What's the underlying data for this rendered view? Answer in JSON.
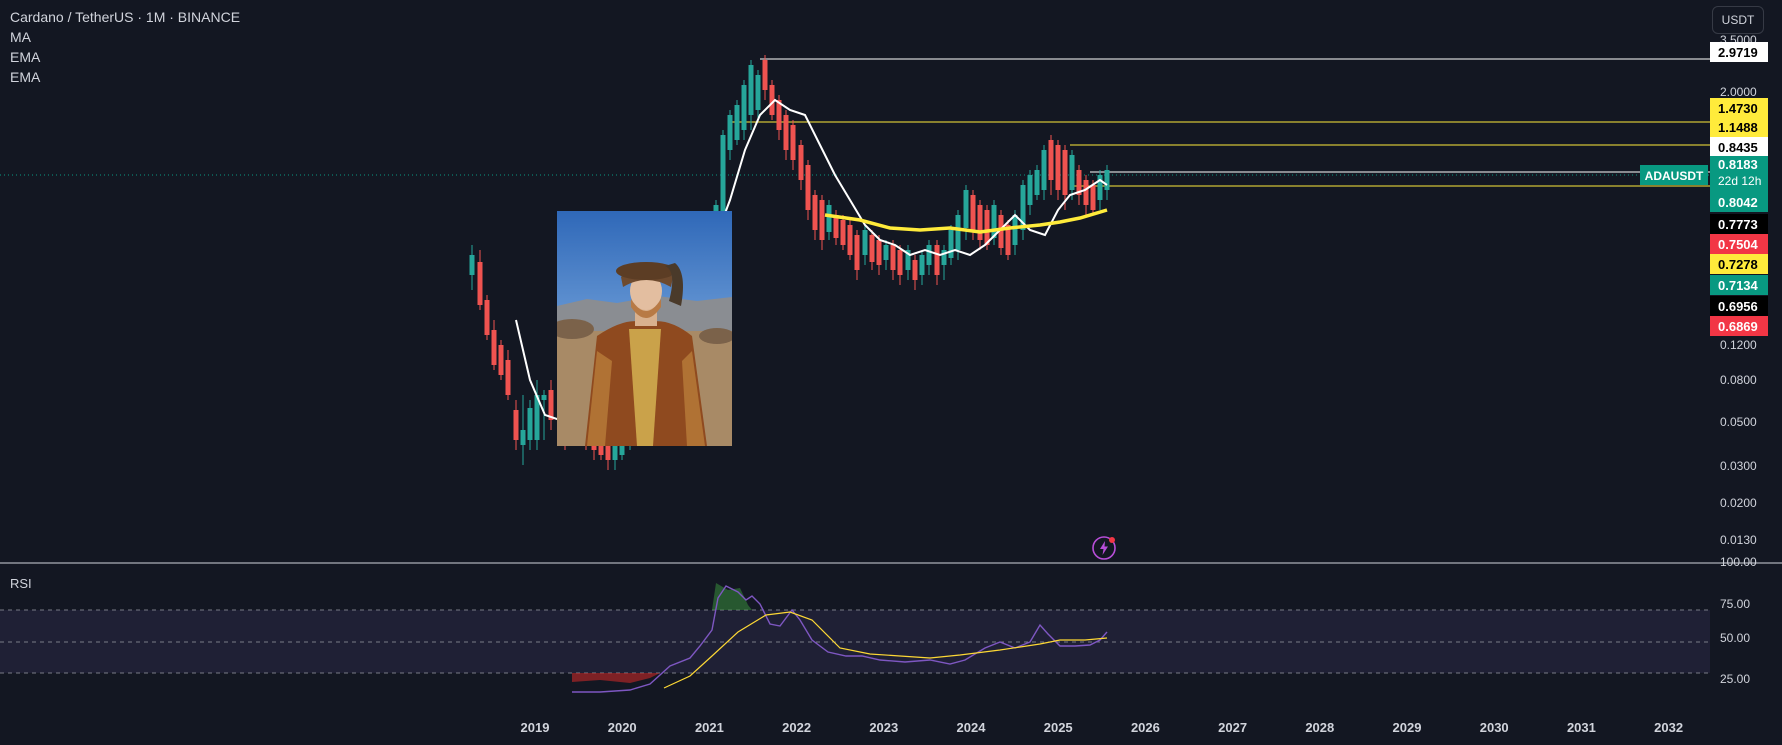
{
  "header": {
    "symbol_title": "Cardano / TetherUS · 1M · BINANCE",
    "indicators": [
      "MA",
      "EMA",
      "EMA"
    ]
  },
  "currency_button": "USDT",
  "rsi": {
    "label": "RSI",
    "axis_ticks": [
      "100.00",
      "75.00",
      "50.00",
      "25.00"
    ]
  },
  "price_axis": {
    "ticks": [
      "3.5000",
      "2.0000",
      "0.1200",
      "0.0800",
      "0.0500",
      "0.0300",
      "0.0200",
      "0.0130"
    ],
    "labels": [
      {
        "value": "2.9719",
        "bg": "#ffffff",
        "fg": "#000000"
      },
      {
        "value": "1.4730",
        "bg": "#ffeb3b",
        "fg": "#000000"
      },
      {
        "value": "1.1488",
        "bg": "#ffeb3b",
        "fg": "#000000"
      },
      {
        "value": "0.8435",
        "bg": "#ffffff",
        "fg": "#000000"
      },
      {
        "value": "0.8183",
        "sub": "22d 12h",
        "bg": "#089981",
        "fg": "#ffffff"
      },
      {
        "value": "0.8042",
        "bg": "#089981",
        "fg": "#ffffff"
      },
      {
        "value": "0.7773",
        "bg": "#000000",
        "fg": "#ffffff"
      },
      {
        "value": "0.7504",
        "bg": "#f23645",
        "fg": "#ffffff"
      },
      {
        "value": "0.7278",
        "bg": "#ffeb3b",
        "fg": "#000000"
      },
      {
        "value": "0.7134",
        "bg": "#089981",
        "fg": "#ffffff"
      },
      {
        "value": "0.6956",
        "bg": "#000000",
        "fg": "#ffffff"
      },
      {
        "value": "0.6869",
        "bg": "#f23645",
        "fg": "#ffffff"
      }
    ],
    "ticker_tag": "ADAUSDT"
  },
  "time_axis": [
    "2019",
    "2020",
    "2021",
    "2022",
    "2023",
    "2024",
    "2025",
    "2026",
    "2027",
    "2028",
    "2029",
    "2030",
    "2031",
    "2032"
  ],
  "colors": {
    "background": "#131722",
    "up": "#26a69a",
    "down": "#ef5350",
    "ma": "#ffffff",
    "ema_long": "#ffeb3b",
    "rsi_line": "#7e57c2",
    "rsi_ma": "#fdd835",
    "accent": "#089981"
  },
  "icons": {
    "photo": "person-portrait-image",
    "alert": "lightning-icon"
  }
}
